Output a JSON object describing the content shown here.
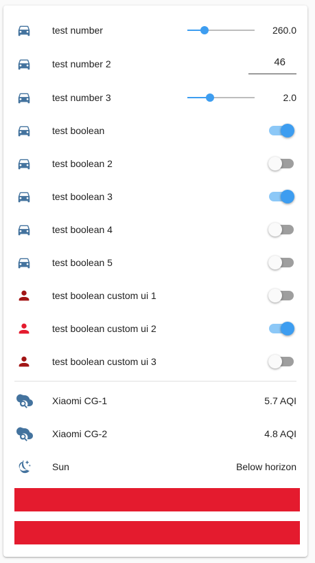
{
  "colors": {
    "accent": "#3d9df0",
    "entity_icon": "#44739e",
    "person_dark": "#a21515",
    "person_red": "#e41b2e",
    "redacted": "#e41b2e"
  },
  "rows": [
    {
      "icon": "car-icon",
      "label": "test number",
      "control": "slider",
      "value": "260.0",
      "level": 0.25
    },
    {
      "icon": "car-icon",
      "label": "test number 2",
      "control": "input",
      "value": "46"
    },
    {
      "icon": "car-icon",
      "label": "test number 3",
      "control": "slider",
      "value": "2.0",
      "level": 0.34
    },
    {
      "icon": "car-icon",
      "label": "test boolean",
      "control": "toggle",
      "on": true
    },
    {
      "icon": "car-icon",
      "label": "test boolean 2",
      "control": "toggle",
      "on": false
    },
    {
      "icon": "car-icon",
      "label": "test boolean 3",
      "control": "toggle",
      "on": true
    },
    {
      "icon": "car-icon",
      "label": "test boolean 4",
      "control": "toggle",
      "on": false
    },
    {
      "icon": "car-icon",
      "label": "test boolean 5",
      "control": "toggle",
      "on": false
    },
    {
      "icon": "person-icon",
      "label": "test boolean custom ui 1",
      "control": "toggle",
      "on": false
    },
    {
      "icon": "person-icon",
      "label": "test boolean custom ui 2",
      "control": "toggle",
      "on": true
    },
    {
      "icon": "person-icon",
      "label": "test boolean custom ui 3",
      "control": "toggle",
      "on": false
    }
  ],
  "sensors": [
    {
      "icon": "cloud-search-icon",
      "label": "Xiaomi CG-1",
      "value": "5.7 AQI"
    },
    {
      "icon": "cloud-search-icon",
      "label": "Xiaomi CG-2",
      "value": "4.8 AQI"
    },
    {
      "icon": "moon-stars-icon",
      "label": "Sun",
      "value": "Below horizon"
    }
  ],
  "persons": [
    {
      "icon": "avatar",
      "redacted": true
    },
    {
      "icon": "avatar",
      "redacted": true
    }
  ]
}
